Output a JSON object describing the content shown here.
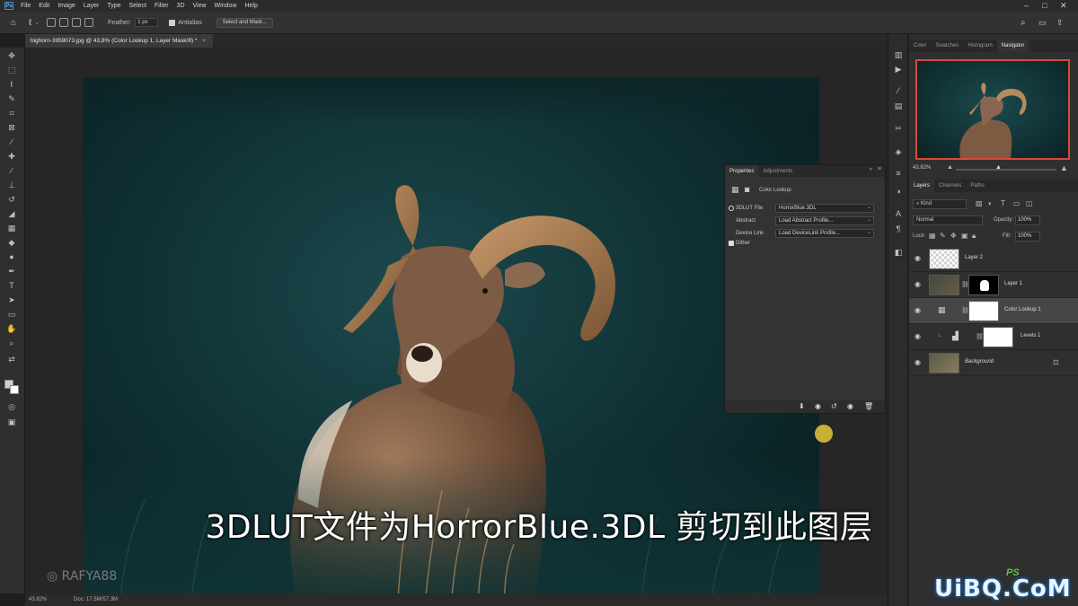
{
  "menubar": {
    "items": [
      "File",
      "Edit",
      "Image",
      "Layer",
      "Type",
      "Select",
      "Filter",
      "3D",
      "View",
      "Window",
      "Help"
    ]
  },
  "options": {
    "feather_label": "Feather:",
    "feather_value": "1 px",
    "antialias_label": "Antialias",
    "select_mask_label": "Select and Mask..."
  },
  "document": {
    "tab_title": "bighorn-3959073.jpg @ 43,8% (Color Lookup 1, Layer Mask/8) *"
  },
  "status": {
    "zoom": "43.82%",
    "doc": "Doc: 17,5M/57,3M"
  },
  "navigator": {
    "tabs": [
      "Color",
      "Swatches",
      "Histogram",
      "Navigator"
    ],
    "active_tab": "Navigator",
    "zoom": "43.82%"
  },
  "layers_panel": {
    "tabs": [
      "Layers",
      "Channels",
      "Paths"
    ],
    "filter": "Kind",
    "blend_mode": "Normal",
    "opacity_label": "Opacity:",
    "opacity": "100%",
    "lock_label": "Lock:",
    "fill_label": "Fill:",
    "fill": "100%",
    "layers": [
      {
        "name": "Layer 2",
        "selected": false
      },
      {
        "name": "Layer 1",
        "selected": false
      },
      {
        "name": "Color Lookup 1",
        "selected": true
      },
      {
        "name": "Levels 1",
        "selected": false
      },
      {
        "name": "Background",
        "selected": false
      }
    ]
  },
  "properties": {
    "tabs": [
      "Properties",
      "Adjustments"
    ],
    "title": "Color Lookup",
    "rows": [
      {
        "label": "3DLUT File",
        "value": "HorrorBlue.3DL"
      },
      {
        "label": "Abstract",
        "value": "Load Abstract Profile..."
      },
      {
        "label": "Device Link",
        "value": "Load DeviceLink Profile..."
      }
    ],
    "dither_label": "Dither"
  },
  "overlay": {
    "subtitle": "3DLUT文件为HorrorBlue.3DL 剪切到此图层",
    "watermark_insta": "RAFYA88",
    "watermark_site": "UiBQ.CoM",
    "ps_brand": "PS"
  },
  "colors": {
    "accent_red": "#d84a3a",
    "panel_bg": "#2f2f2f",
    "photo_teal": "#123538"
  }
}
